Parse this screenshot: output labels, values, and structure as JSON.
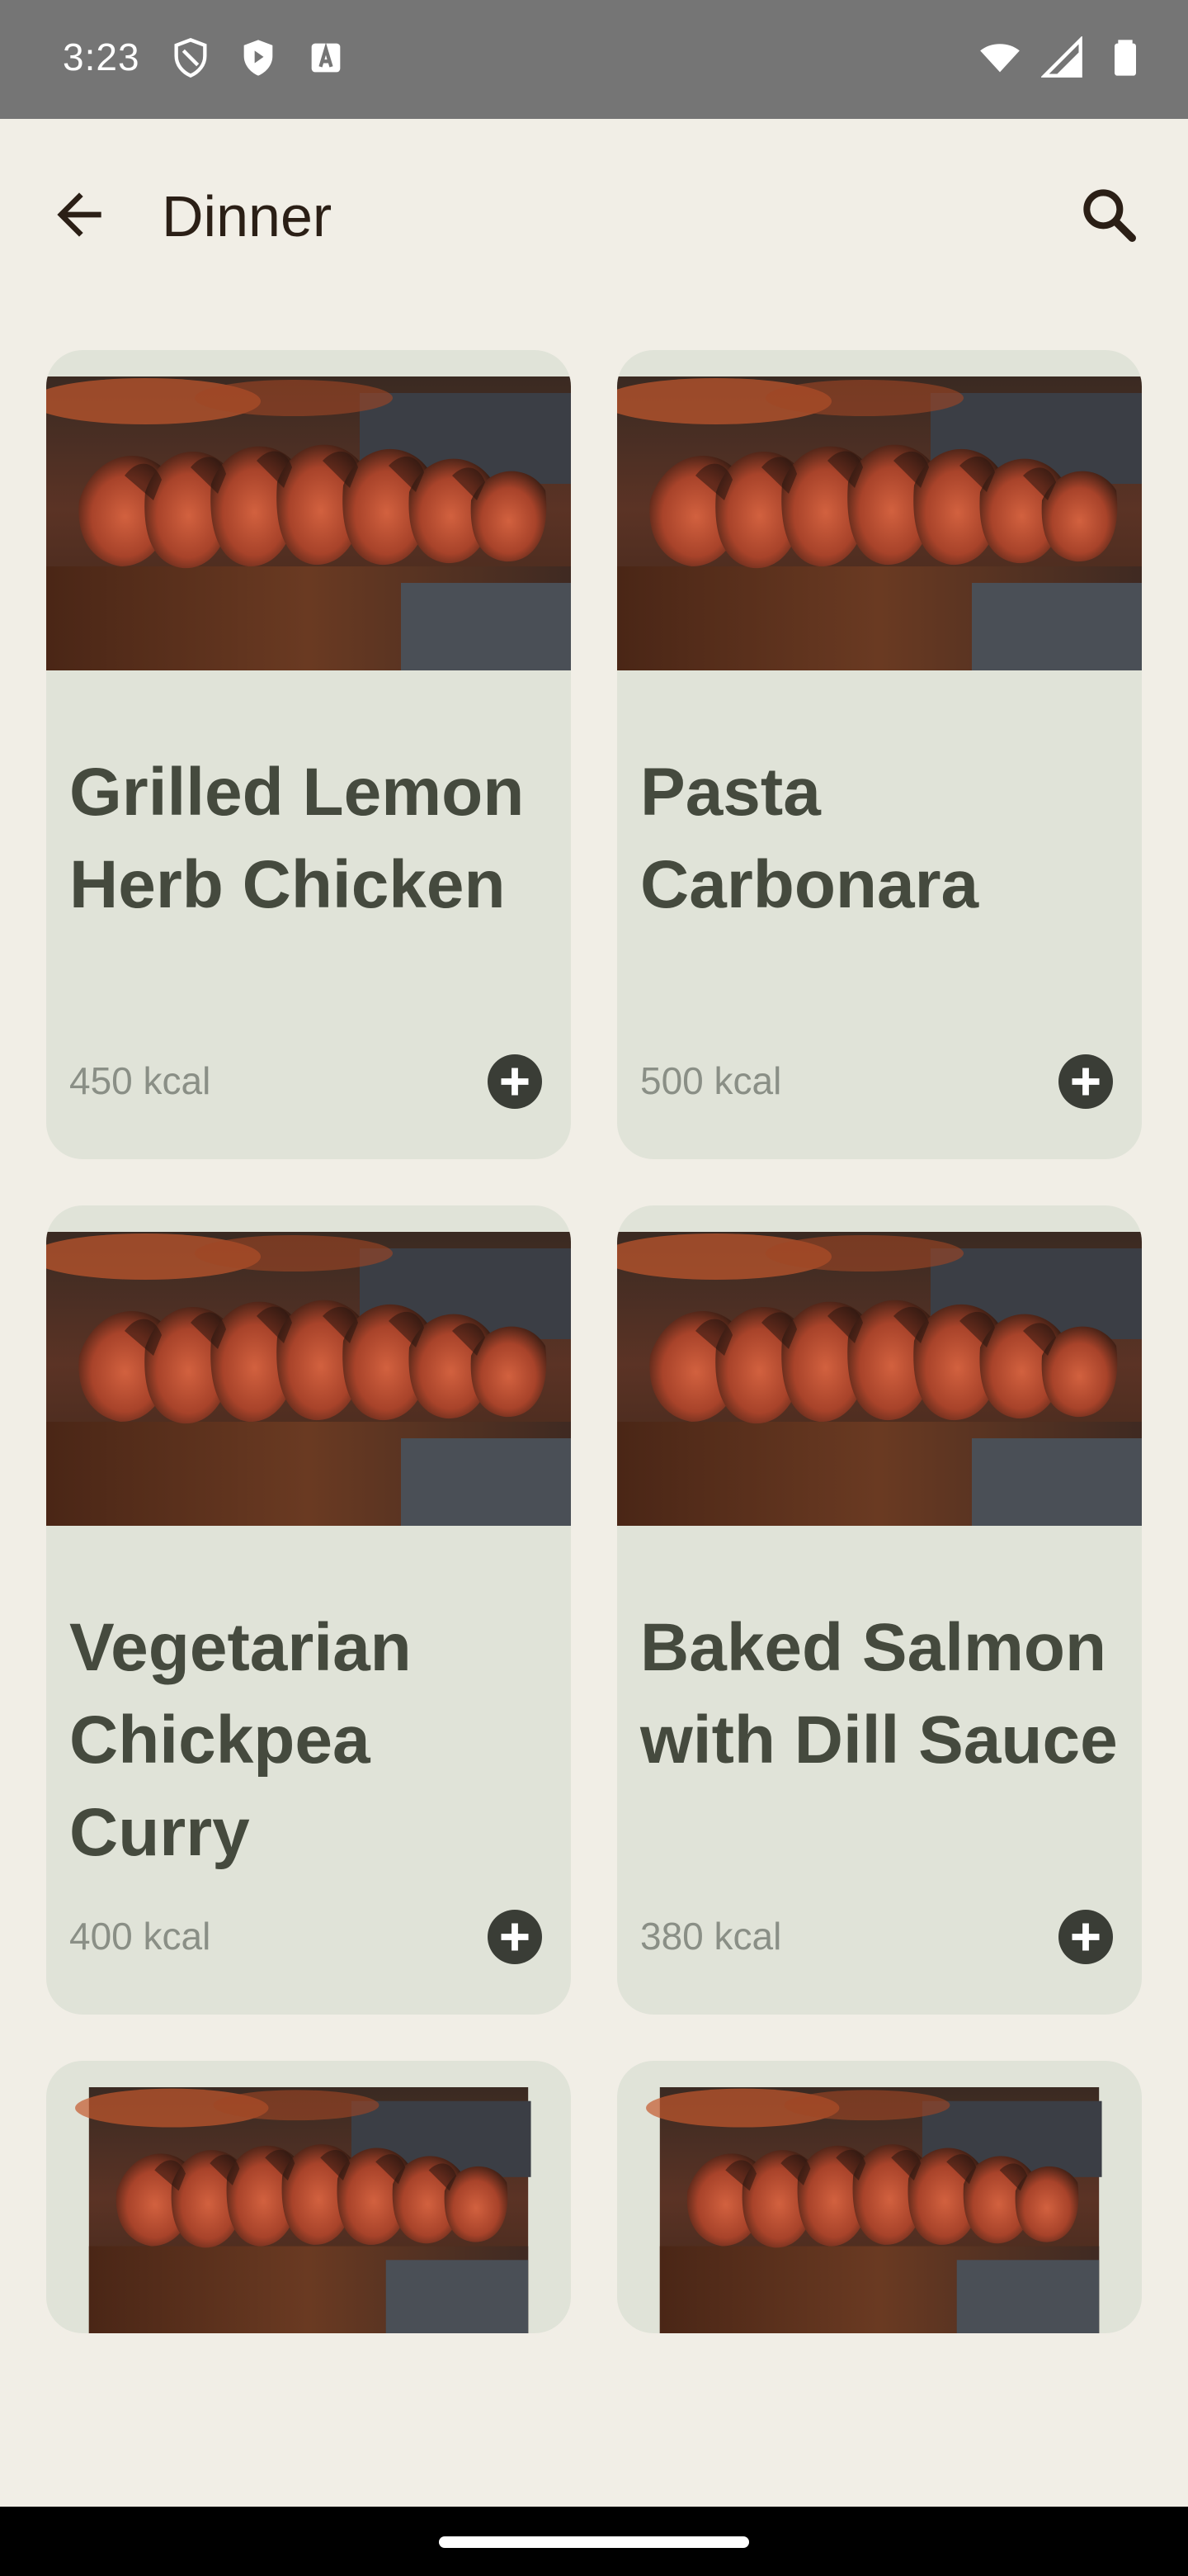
{
  "status_bar": {
    "time": "3:23",
    "icons": [
      "shield-icon",
      "play-protect-icon",
      "text-icon",
      "wifi-icon",
      "signal-icon",
      "battery-icon"
    ]
  },
  "app_bar": {
    "title": "Dinner",
    "back_icon": "arrow-back-icon",
    "search_icon": "search-icon"
  },
  "recipes": [
    {
      "title": "Grilled Lemon Herb Chicken",
      "kcal": "450 kcal"
    },
    {
      "title": "Pasta Carbonara",
      "kcal": "500 kcal"
    },
    {
      "title": "Vegetarian Chickpea Curry",
      "kcal": "400 kcal"
    },
    {
      "title": "Baked Salmon with Dill Sauce",
      "kcal": "380 kcal"
    }
  ],
  "colors": {
    "background": "#F1EEE6",
    "card": "#E0E3D8",
    "title_text": "#454A3E",
    "add_button": "#3A3D36"
  }
}
